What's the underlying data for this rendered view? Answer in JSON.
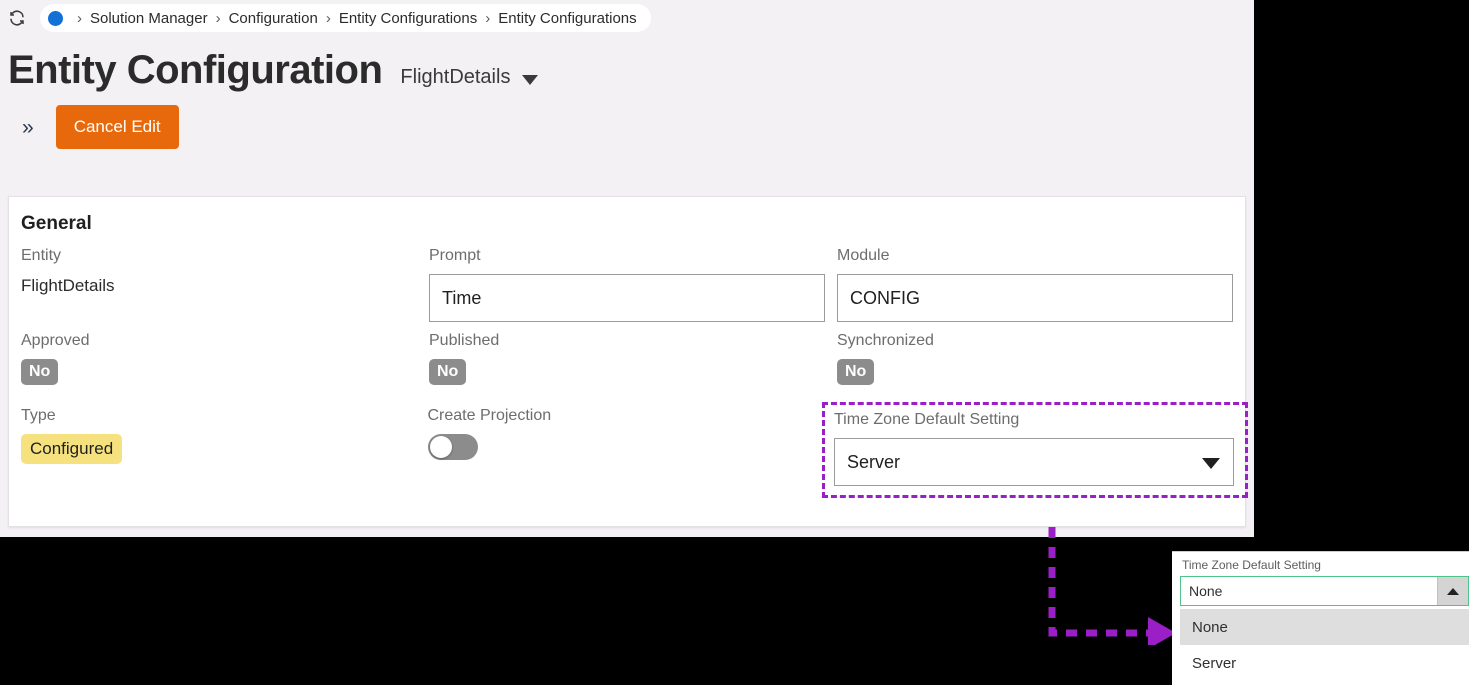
{
  "breadcrumb": {
    "refresh_icon": "refresh-icon",
    "status_dot": "blue-dot-icon",
    "separator": "›",
    "items": [
      "Solution Manager",
      "Configuration",
      "Entity Configurations",
      "Entity Configurations"
    ]
  },
  "header": {
    "title": "Entity Configuration",
    "entity_selector_value": "FlightDetails",
    "entity_selector_icon": "chevron-down-icon"
  },
  "toolbar": {
    "expand_icon": "»",
    "cancel_edit_label": "Cancel Edit",
    "cancel_edit_color": "#e8690b"
  },
  "card": {
    "section_title": "General",
    "fields": {
      "entity": {
        "label": "Entity",
        "value": "FlightDetails"
      },
      "prompt": {
        "label": "Prompt",
        "value": "Time",
        "placeholder": ""
      },
      "module": {
        "label": "Module",
        "value": "CONFIG",
        "placeholder": ""
      },
      "approved": {
        "label": "Approved",
        "value": "No"
      },
      "published": {
        "label": "Published",
        "value": "No"
      },
      "synchronized": {
        "label": "Synchronized",
        "value": "No"
      },
      "type": {
        "label": "Type",
        "value": "Configured",
        "badge_color": "#f5e27e"
      },
      "create_projection": {
        "label": "Create Projection",
        "value": "off"
      },
      "time_zone_default_setting": {
        "label": "Time Zone Default Setting",
        "value": "Server",
        "caret_icon": "caret-down-icon",
        "highlight_color": "#9b1fc7"
      }
    }
  },
  "annotation": {
    "connector_color": "#9b1fc7",
    "arrow_icon": "arrow-right-icon"
  },
  "inset": {
    "label": "Time Zone Default Setting",
    "selected_value": "None",
    "toggle_icon": "caret-up-icon",
    "focus_color": "#4fc48a",
    "options": [
      {
        "label": "None",
        "selected": true
      },
      {
        "label": "Server",
        "selected": false
      }
    ]
  }
}
